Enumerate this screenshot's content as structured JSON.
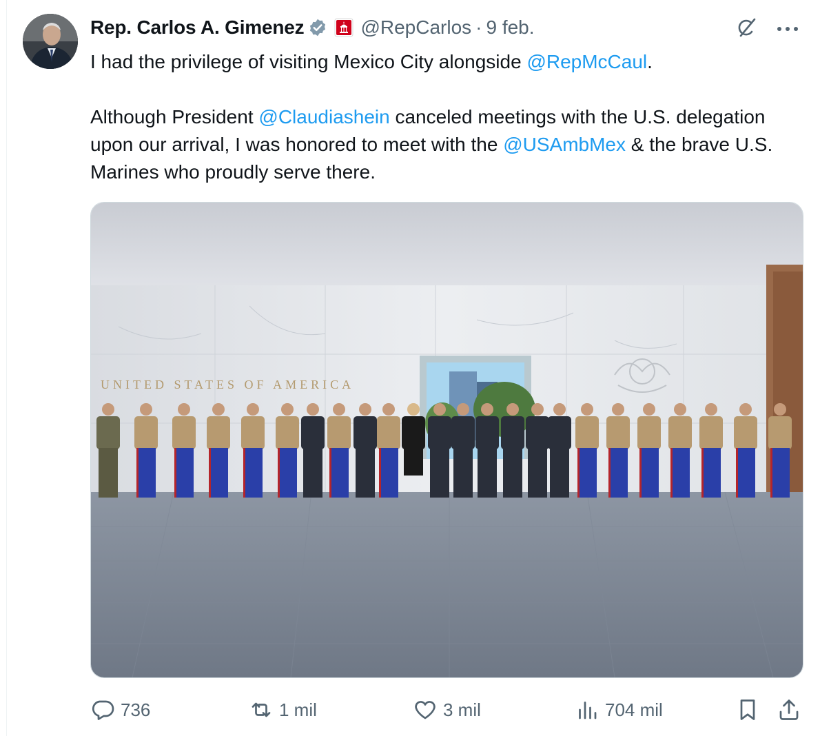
{
  "post": {
    "author_name": "Rep. Carlos A. Gimenez",
    "handle": "@RepCarlos",
    "separator": "·",
    "date": "9 feb.",
    "text": {
      "p1_a": "I had the privilege of visiting Mexico City alongside ",
      "p1_mention": "@RepMcCaul",
      "p1_b": ".",
      "p2_a": "Although President ",
      "p2_mention1": "@Claudiashein",
      "p2_b": " canceled meetings with the U.S. delegation upon our arrival, I was honored to meet with the ",
      "p2_mention2": "@USAmbMex",
      "p2_c": " & the brave U.S. Marines who proudly serve there."
    },
    "photo": {
      "wall_inscription": "UNITED STATES OF AMERICA"
    }
  },
  "actions": {
    "replies": "736",
    "reposts": "1 mil",
    "likes": "3 mil",
    "views": "704 mil"
  },
  "colors": {
    "accent": "#1d9bf0",
    "muted_text": "#536471",
    "border": "#cfd9de",
    "text": "#0f1419"
  },
  "icons": [
    "verified-badge-icon",
    "government-building-icon",
    "grok-icon",
    "more-options-icon",
    "reply-icon",
    "repost-icon",
    "like-icon",
    "views-icon",
    "bookmark-icon",
    "share-icon"
  ]
}
